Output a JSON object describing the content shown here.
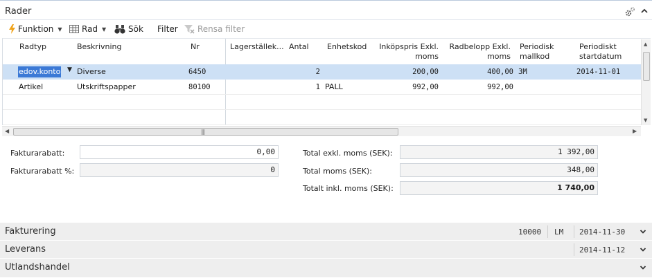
{
  "panel": {
    "title": "Rader"
  },
  "actions": {
    "funktion": "Funktion",
    "rad": "Rad",
    "sok": "Sök",
    "filter": "Filter",
    "rensa_filter": "Rensa filter"
  },
  "grid": {
    "headers": {
      "radtyp": "Radtyp",
      "beskrivning": "Beskrivning",
      "nr": "Nr",
      "lagerstalle": "Lagerställek...",
      "antal": "Antal",
      "enhetskod": "Enhetskod",
      "inkopspris_1": "Inköpspris Exkl.",
      "inkopspris_2": "moms",
      "radbelopp_1": "Radbelopp Exkl.",
      "radbelopp_2": "moms",
      "periodisk_1": "Periodisk",
      "periodisk_2": "mallkod",
      "periodiskt_1": "Periodiskt",
      "periodiskt_2": "startdatum"
    },
    "rows": [
      {
        "radtyp": "edov.konto",
        "beskrivning": "Diverse",
        "nr": "6450",
        "lagerstalle": "",
        "antal": "2",
        "enhetskod": "",
        "inkopspris": "200,00",
        "radbelopp": "400,00",
        "periodisk": "3M",
        "startdatum": "2014-11-01"
      },
      {
        "radtyp": "Artikel",
        "beskrivning": "Utskriftspapper",
        "nr": "80100",
        "lagerstalle": "",
        "antal": "1",
        "enhetskod": "PALL",
        "inkopspris": "992,00",
        "radbelopp": "992,00",
        "periodisk": "",
        "startdatum": ""
      }
    ]
  },
  "totals": {
    "fakturarabatt_label": "Fakturarabatt:",
    "fakturarabatt_value": "0,00",
    "fakturarabatt_pct_label": "Fakturarabatt %:",
    "fakturarabatt_pct_value": "0",
    "total_exkl_label": "Total exkl. moms (SEK):",
    "total_exkl_value": "1 392,00",
    "total_moms_label": "Total moms (SEK):",
    "total_moms_value": "348,00",
    "totalt_inkl_label": "Totalt inkl. moms (SEK):",
    "totalt_inkl_value": "1 740,00"
  },
  "sections": {
    "fakturering": {
      "title": "Fakturering",
      "value1": "10000",
      "value2": "LM",
      "date": "2014-11-30"
    },
    "leverans": {
      "title": "Leverans",
      "date": "2014-11-12"
    },
    "utlandshandel": {
      "title": "Utlandshandel"
    }
  },
  "colors": {
    "selected_row": "#cde0f5",
    "edit_highlight": "#3b79d6",
    "section_bg": "#eeeeee"
  }
}
